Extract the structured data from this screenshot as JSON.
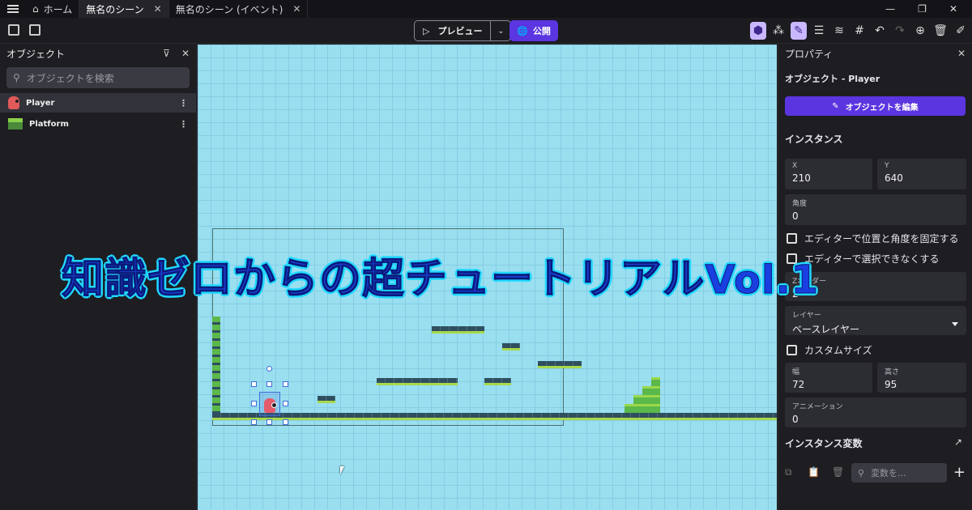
{
  "tabs": [
    {
      "label": "ホーム"
    },
    {
      "label": "無名のシーン"
    },
    {
      "label": "無名のシーン (イベント)"
    }
  ],
  "toolbar": {
    "preview_label": "プレビュー",
    "publish_label": "公開"
  },
  "objects_panel": {
    "title": "オブジェクト",
    "search_placeholder": "オブジェクトを検索",
    "items": [
      {
        "name": "Player"
      },
      {
        "name": "Platform"
      }
    ]
  },
  "properties_panel": {
    "title": "プロパティ",
    "object_label": "オブジェクト  - Player",
    "edit_object_label": "オブジェクトを編集",
    "instance_section": "インスタンス",
    "x_label": "X",
    "x_value": "210",
    "y_label": "Y",
    "y_value": "640",
    "angle_label": "角度",
    "angle_value": "0",
    "lock_label": "エディターで位置と角度を固定する",
    "second_check_label": "エディターで選択できなくする",
    "zorder_label": "Zオーダー",
    "zorder_value": "2",
    "layer_label": "レイヤー",
    "layer_value": "ベースレイヤー",
    "custom_size_label": "カスタムサイズ",
    "width_label": "幅",
    "width_value": "72",
    "height_label": "高さ",
    "height_value": "95",
    "animation_label": "アニメーション",
    "animation_value": "0",
    "instance_vars_label": "インスタンス変数",
    "var_search_placeholder": "変数を..."
  },
  "overlay": {
    "title": "知識ゼロからの超チュートリアル",
    "vol": "Vol.1"
  },
  "colors": {
    "accent": "#5b35e0",
    "canvas_bg": "#9adff0",
    "overlay_fill": "#1b3fd0",
    "overlay_outline": "#21d8ff"
  }
}
